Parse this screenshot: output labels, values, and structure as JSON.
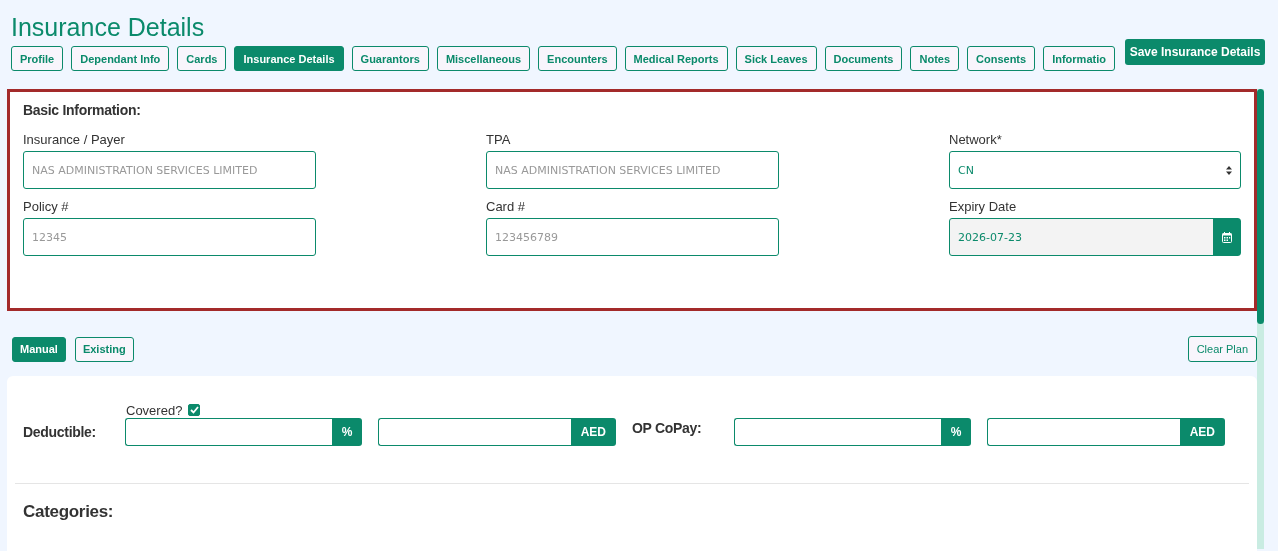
{
  "page_title": "Insurance Details",
  "tabs": [
    {
      "label": "Profile",
      "selected": false
    },
    {
      "label": "Dependant Info",
      "selected": false
    },
    {
      "label": "Cards",
      "selected": false
    },
    {
      "label": "Insurance Details",
      "selected": true
    },
    {
      "label": "Guarantors",
      "selected": false
    },
    {
      "label": "Miscellaneous",
      "selected": false
    },
    {
      "label": "Encounters",
      "selected": false
    },
    {
      "label": "Medical Reports",
      "selected": false
    },
    {
      "label": "Sick Leaves",
      "selected": false
    },
    {
      "label": "Documents",
      "selected": false
    },
    {
      "label": "Notes",
      "selected": false
    },
    {
      "label": "Consents",
      "selected": false
    },
    {
      "label": "Informatio",
      "selected": false
    }
  ],
  "save_button": "Save Insurance Details",
  "basic_information": {
    "heading": "Basic Information:",
    "fields": [
      {
        "label": "Insurance / Payer",
        "kind": "text",
        "placeholder": "NAS ADMINISTRATION SERVICES LIMITED"
      },
      {
        "label": "TPA",
        "kind": "text",
        "placeholder": "NAS ADMINISTRATION SERVICES LIMITED"
      },
      {
        "label": "Network*",
        "kind": "select",
        "value": "CN"
      },
      {
        "label": "Policy #",
        "kind": "text",
        "placeholder": "12345"
      },
      {
        "label": "Card #",
        "kind": "text",
        "placeholder": "123456789"
      },
      {
        "label": "Expiry Date",
        "kind": "date",
        "value": "2026-07-23"
      }
    ]
  },
  "plan_modes": [
    {
      "label": "Manual",
      "selected": true
    },
    {
      "label": "Existing",
      "selected": false
    }
  ],
  "clear_plan_button": "Clear Plan",
  "deductible": {
    "label": "Deductible:",
    "covered_label": "Covered?",
    "covered": true,
    "percent_addon": "%",
    "amount_addon": "AED"
  },
  "op_copay": {
    "label": "OP CoPay:",
    "percent_addon": "%",
    "amount_addon": "AED"
  },
  "categories_heading": "Categories:"
}
